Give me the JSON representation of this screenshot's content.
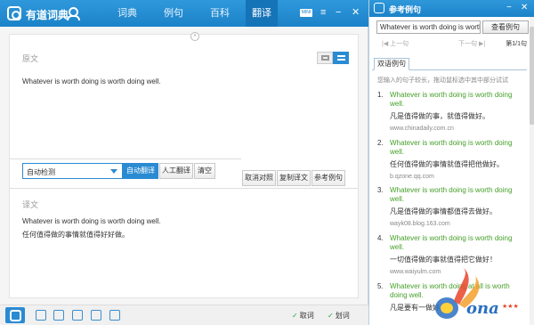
{
  "topbar": {
    "app_title": "有道词典",
    "tabs": [
      {
        "label": "词典",
        "active": false
      },
      {
        "label": "例句",
        "active": false
      },
      {
        "label": "百科",
        "active": false
      },
      {
        "label": "翻译",
        "active": true
      }
    ],
    "mini_badge": "MINI"
  },
  "source": {
    "label": "原文",
    "text": "Whatever is worth doing is worth doing well."
  },
  "controls": {
    "language_select": "自动检测",
    "auto_translate": "自动翻译",
    "human_translate": "人工翻译",
    "clear": "清空",
    "cancel_compare": "取消对照",
    "copy_translation": "复制译文",
    "reference_examples": "参考例句"
  },
  "target": {
    "label": "译文",
    "line_en": "Whatever is worth doing is worth doing well.",
    "line_zh": "任何值得做的事情就值得好好做。"
  },
  "bottombar": {
    "word_pick": "取词",
    "word_select": "划词"
  },
  "panel": {
    "title": "参考例句",
    "input_value": "Whatever is worth doing is worth doing well.",
    "search_button": "查看例句",
    "prev": "上一句",
    "next": "下一句",
    "page_count": "第1/1句",
    "tab": "双语例句",
    "hint": "您输入的句子较长，拖动鼠标选中其中部分试试",
    "examples": [
      {
        "num": "1.",
        "en": "Whatever is worth doing is worth doing well.",
        "zh": "凡是值得做的事，就值得做好。",
        "src": "www.chinadaily.com.cn"
      },
      {
        "num": "2.",
        "en": "Whatever is worth doing is worth doing well.",
        "zh": "任何值得做的事情就值得把他做好。",
        "src": "b.qzone.qq.com"
      },
      {
        "num": "3.",
        "en": "Whatever is worth doing is worth doing well.",
        "zh": "凡是值得做的事情都值得去做好。",
        "src": "wayk08.blog.163.com"
      },
      {
        "num": "4.",
        "en": "Whatever is worth doing is worth doing well.",
        "zh": "一切值得做的事就值得把它做好！",
        "src": "www.waiyulm.com"
      },
      {
        "num": "5.",
        "en": "Whatever is worth doing at all is worth doing well.",
        "zh": "凡是要有一做好。",
        "src": ""
      }
    ]
  },
  "colors": {
    "brand_blue": "#1c82c8",
    "accent_green": "#46a02a"
  }
}
